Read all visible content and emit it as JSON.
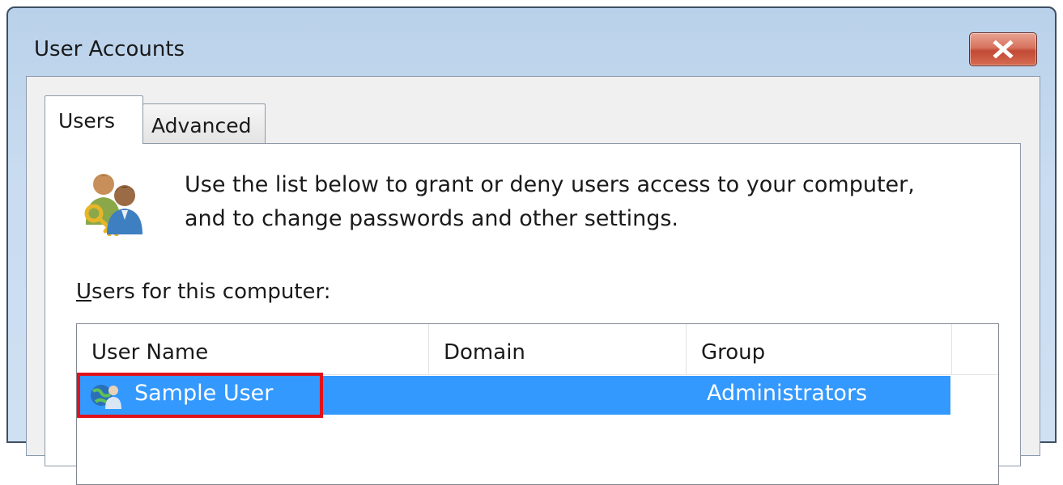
{
  "window": {
    "title": "User Accounts",
    "close_icon": "close-icon"
  },
  "tabs": [
    {
      "label": "Users",
      "selected": true
    },
    {
      "label": "Advanced",
      "selected": false
    }
  ],
  "users_tab": {
    "icon": "users-key-icon",
    "description_line1": "Use the list below to grant or deny users access to your computer,",
    "description_line2": "and to change passwords and other settings.",
    "list_label_accel": "U",
    "list_label_rest": "sers for this computer:"
  },
  "users_list": {
    "columns": [
      "User Name",
      "Domain",
      "Group"
    ],
    "rows": [
      {
        "user_name": "Sample User",
        "domain": "",
        "group": "Administrators",
        "selected": true,
        "icon": "user-globe-icon"
      }
    ]
  },
  "colors": {
    "selection": "#3399ff",
    "annotation_highlight": "#e0121b",
    "close_button": "#c24a35"
  }
}
